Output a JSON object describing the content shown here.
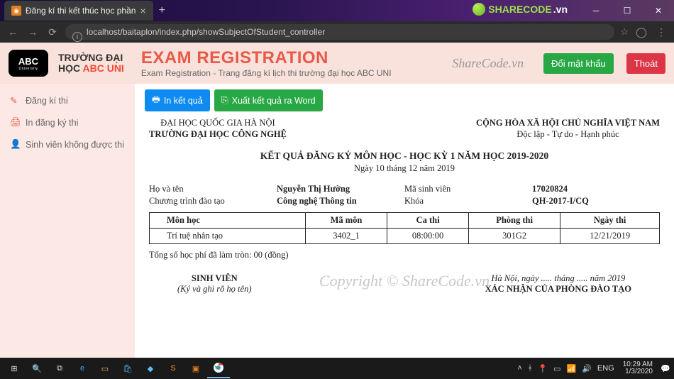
{
  "browser": {
    "tab_title": "Đăng kí thi kết thúc học phần",
    "url": "localhost/baitaplon/index.php/showSubjectOfStudent_controller",
    "watermark_logo_text": "SHARECODE",
    "watermark_logo_suffix": ".vn"
  },
  "header": {
    "brand_line1": "TRƯỜNG ĐẠI",
    "brand_line2_prefix": "HỌC ",
    "brand_line2_abc": "ABC UNI",
    "logo_text": "ABC",
    "logo_sub": "University",
    "title": "EXAM REGISTRATION",
    "subtitle": "Exam Registration - Trang đăng kí lịch thi trường đại học ABC UNI",
    "watermark": "ShareCode.vn",
    "change_pw": "Đổi mật khẩu",
    "logout": "Thoát"
  },
  "sidebar": {
    "items": [
      {
        "label": "Đăng kí thi"
      },
      {
        "label": "In đăng ký thi"
      },
      {
        "label": "Sinh viên không được thi"
      }
    ]
  },
  "buttons": {
    "print": "In kết quả",
    "export": "Xuất kết quả ra Word"
  },
  "doc": {
    "left1": "ĐẠI HỌC QUỐC GIA HÀ NỘI",
    "left2": "TRƯỜNG ĐẠI HỌC CÔNG NGHỆ",
    "right1": "CỘNG HÒA XÃ HỘI CHỦ NGHĨA VIỆT NAM",
    "right2": "Độc lập - Tự do - Hạnh phúc",
    "title": "KẾT QUẢ ĐĂNG KÝ MÔN HỌC - HỌC KỲ 1 NĂM HỌC 2019-2020",
    "date": "Ngày 10 tháng 12 năm 2019",
    "fullname_lbl": "Họ và tên",
    "fullname": "Nguyễn Thị Hường",
    "studentid_lbl": "Mã sinh viên",
    "studentid": "17020824",
    "program_lbl": "Chương trình đào tạo",
    "program": "Công nghệ Thông tin",
    "cohort_lbl": "Khóa",
    "cohort": "QH-2017-I/CQ",
    "columns": [
      "Môn học",
      "Mã môn",
      "Ca thi",
      "Phòng thi",
      "Ngày thi"
    ],
    "rows": [
      {
        "c0": "Trí tuệ nhân tạo",
        "c1": "3402_1",
        "c2": "08:00:00",
        "c3": "301G2",
        "c4": "12/21/2019"
      }
    ],
    "total": "Tổng số học phí đã làm tròn: 00 (đồng)",
    "sig_left_title": "SINH VIÊN",
    "sig_left_note": "(Ký và ghi rõ họ tên)",
    "sig_right_date": "Hà Nội, ngày ..... tháng ..... năm 2019",
    "sig_right_title": "XÁC NHẬN CỦA PHÒNG ĐÀO TẠO"
  },
  "watermark_big": "Copyright © ShareCode.vn",
  "taskbar": {
    "lang": "ENG",
    "time": "10:29 AM",
    "date": "1/3/2020"
  }
}
